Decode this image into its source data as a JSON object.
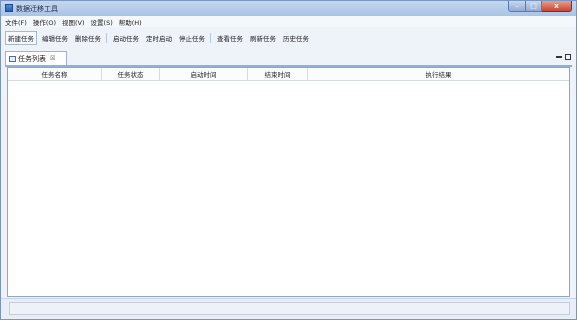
{
  "window": {
    "title": "数据迁移工具",
    "controls": {
      "minimize": "–",
      "maximize": "□",
      "close": "x"
    }
  },
  "menu": [
    "文件(F)",
    "操作(O)",
    "视图(V)",
    "设置(S)",
    "帮助(H)"
  ],
  "toolbar": {
    "group1": [
      "新建任务",
      "编辑任务",
      "删除任务"
    ],
    "group2": [
      "启动任务",
      "定时启动",
      "停止任务"
    ],
    "group3": [
      "查看任务",
      "刷新任务",
      "历史任务"
    ]
  },
  "view": {
    "tab_label": "任务列表",
    "tab_close": "☒"
  },
  "table": {
    "columns": [
      "任务名称",
      "任务状态",
      "启动时间",
      "结束时间",
      "执行结果"
    ],
    "rows": []
  }
}
